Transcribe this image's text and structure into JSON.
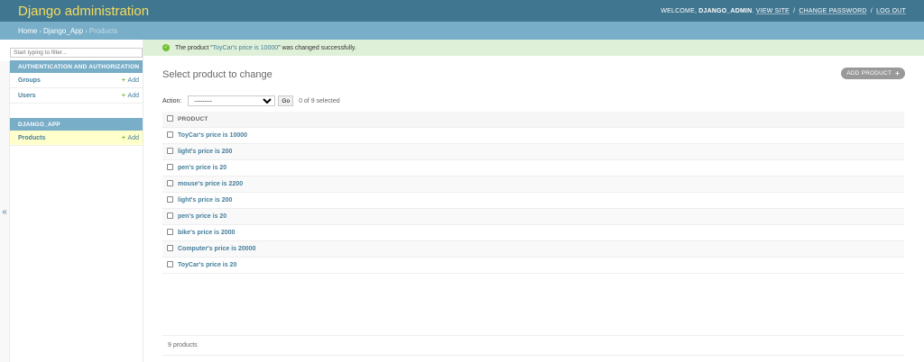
{
  "header": {
    "site_name": "Django administration",
    "welcome": "WELCOME,",
    "username": "DJANGO_ADMIN",
    "view_site": "VIEW SITE",
    "change_password": "CHANGE PASSWORD",
    "log_out": "LOG OUT",
    "separator": "/"
  },
  "breadcrumbs": {
    "home": "Home",
    "app": "Django_App",
    "current": "Products",
    "arrow": "›"
  },
  "sidebar": {
    "filter_placeholder": "Start typing to filter...",
    "toggle": "«",
    "modules": [
      {
        "caption": "AUTHENTICATION AND AUTHORIZATION",
        "rows": [
          {
            "label": "Groups",
            "add": "Add"
          },
          {
            "label": "Users",
            "add": "Add"
          }
        ]
      },
      {
        "caption": "DJANGO_APP",
        "rows": [
          {
            "label": "Products",
            "add": "Add"
          }
        ]
      }
    ],
    "add_plus": "+"
  },
  "message": {
    "check": "✓",
    "prefix": "The product “",
    "link": "ToyCar's price is 10000",
    "suffix": "” was changed successfully."
  },
  "main": {
    "title": "Select product to change",
    "add_button": "ADD PRODUCT",
    "add_plus": "+",
    "action_label": "Action:",
    "action_selected": "---------",
    "go": "Go",
    "counter": "0 of 9 selected",
    "column_header": "PRODUCT",
    "rows": [
      "ToyCar's price is 10000",
      "light's price is 200",
      "pen's price is 20",
      "mouse's price is 2200",
      "light's price is 200",
      "pen's price is 20",
      "bike's price is 2000",
      "Computer's price is 20000",
      "ToyCar's price is 20"
    ],
    "paginator": "9 products"
  },
  "colors": {
    "header_bg": "#417690",
    "site_name": "#f5dd5d",
    "breadcrumb_bg": "#79aec8",
    "link": "#447e9b",
    "success_bg": "#dff0d8",
    "add_green": "#70bf2b",
    "current_row": "#ffffcc"
  }
}
